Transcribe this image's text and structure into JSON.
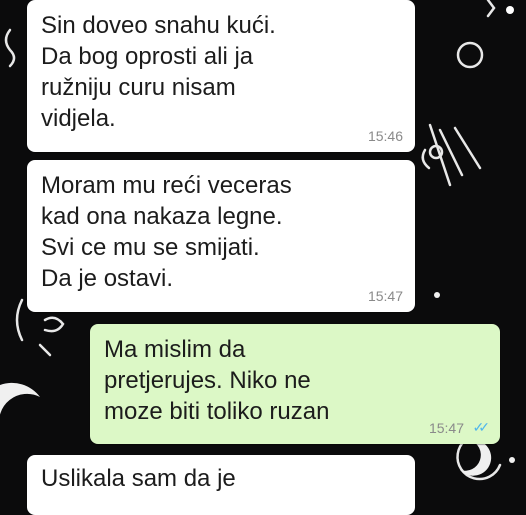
{
  "chat": {
    "messages": [
      {
        "direction": "incoming",
        "text": "Sin doveo snahu kući.\nDa bog oprosti ali ja\nružniju curu nisam\nvidjela.",
        "time": "15:46"
      },
      {
        "direction": "incoming",
        "text": "Moram mu reći veceras\nkad ona nakaza legne.\nSvi ce mu se smijati.\nDa je ostavi.",
        "time": "15:47"
      },
      {
        "direction": "outgoing",
        "text": "Ma mislim da\npretjerujes. Niko ne\nmoze biti toliko ruzan",
        "time": "15:47",
        "status_icon": "double-check-read-icon"
      },
      {
        "direction": "incoming",
        "text": "Uslikala sam da je",
        "time": ""
      }
    ],
    "colors": {
      "wallpaper": "#0b0b0c",
      "incoming_bubble": "#ffffff",
      "outgoing_bubble": "#dcf8c6",
      "read_ticks": "#4fb6ec"
    }
  }
}
